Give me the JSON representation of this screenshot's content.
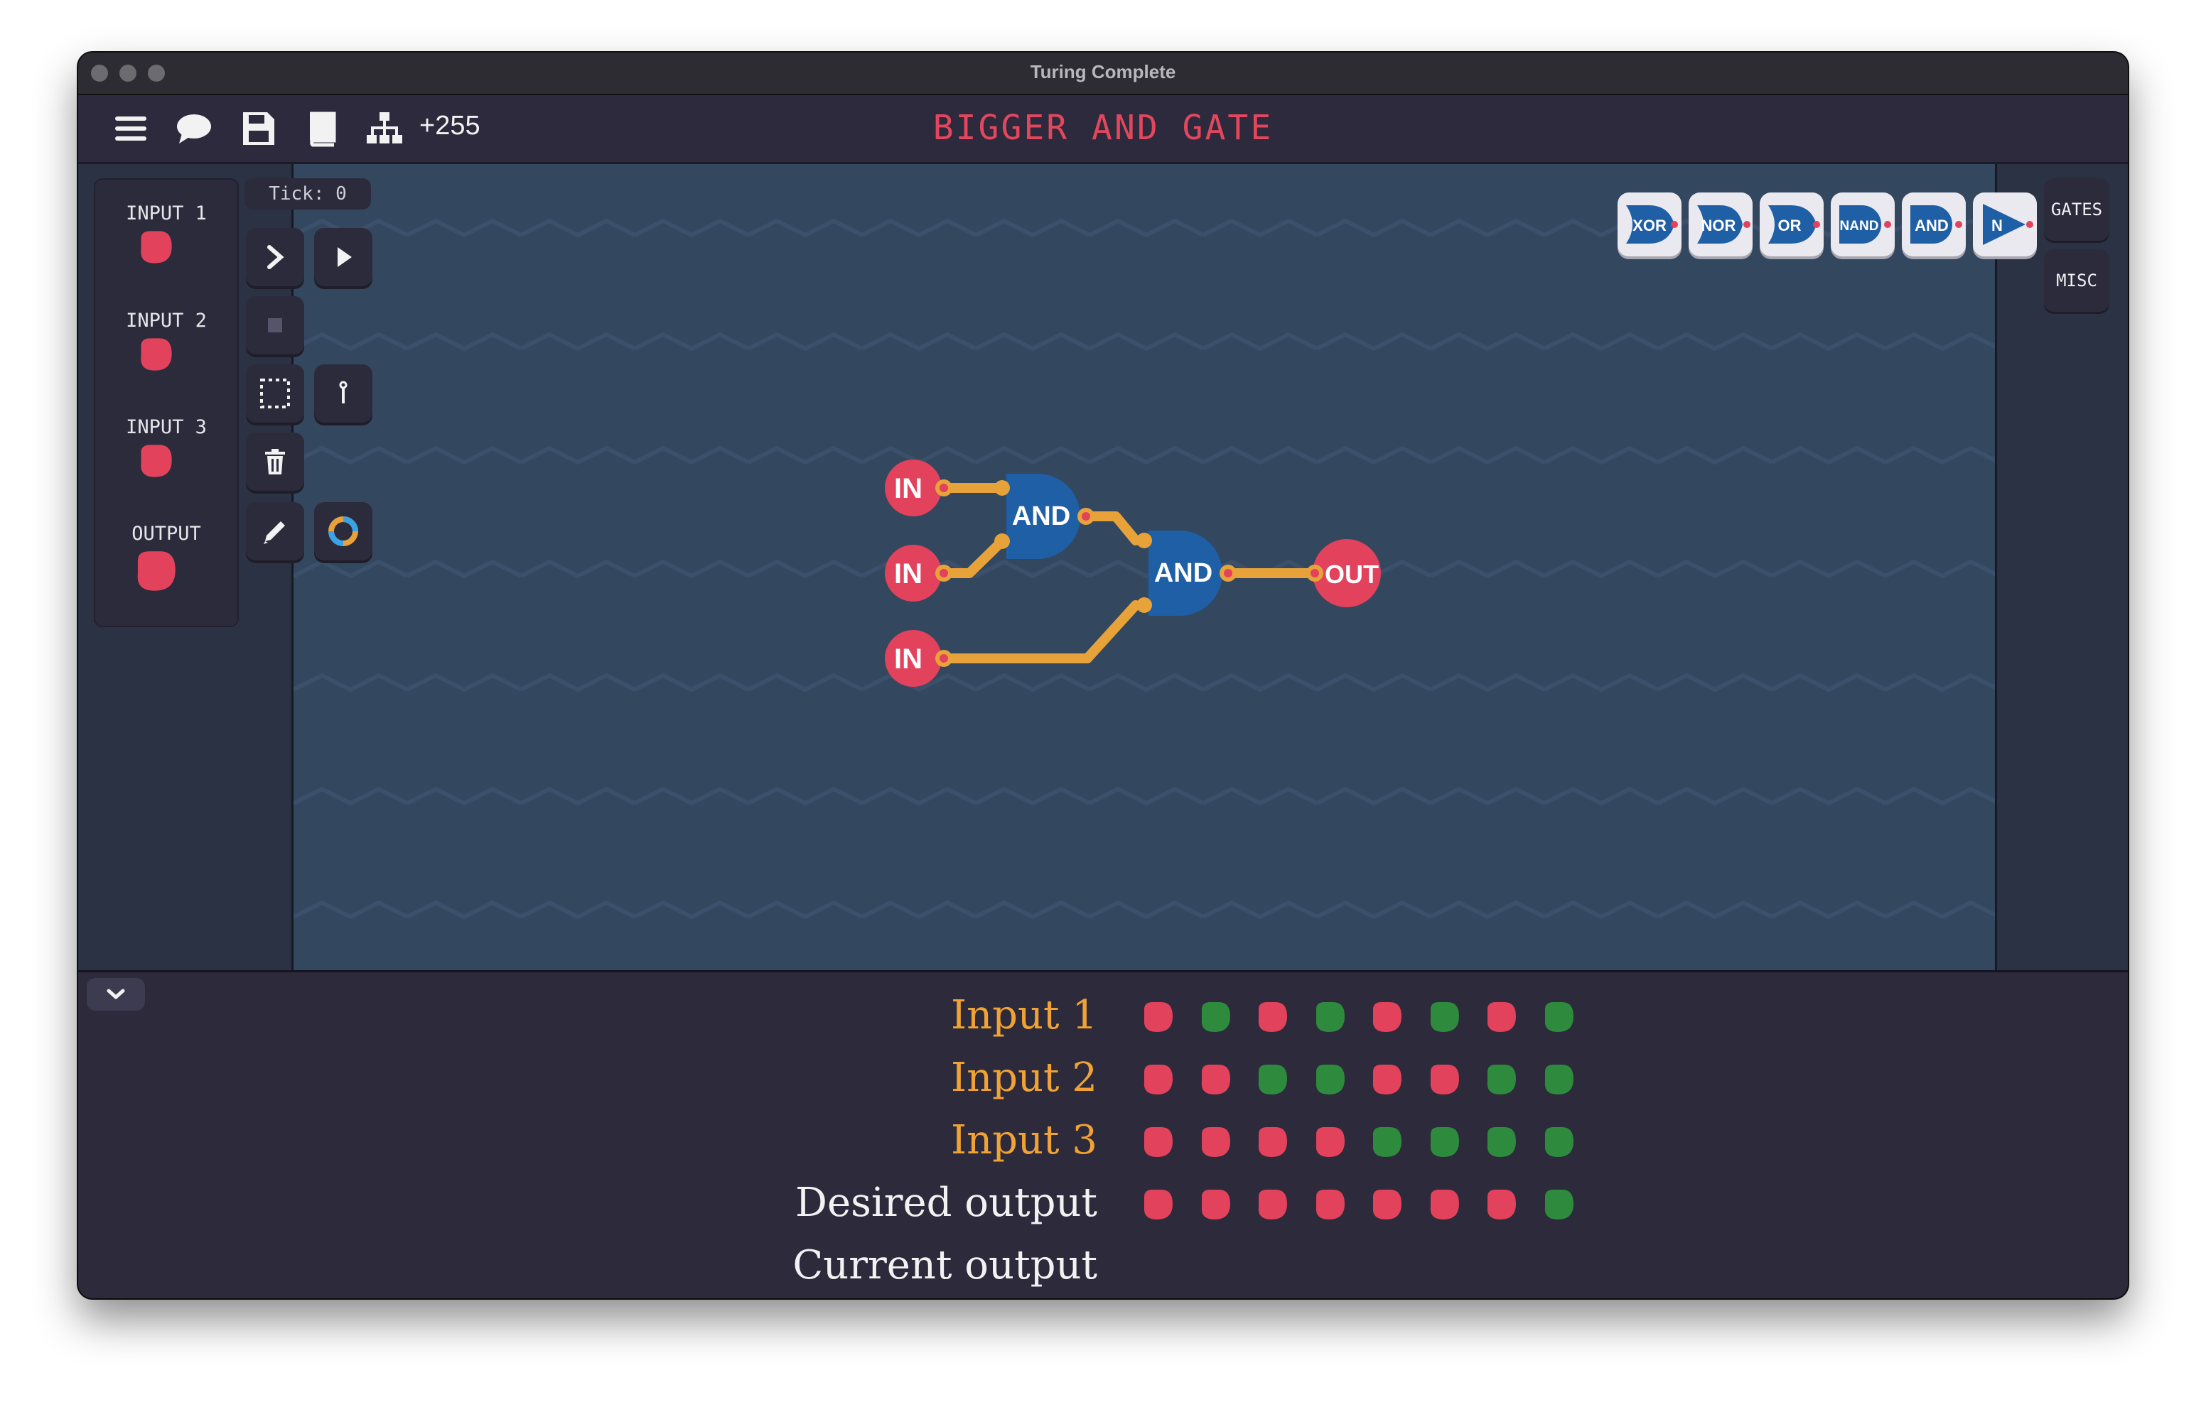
{
  "window": {
    "title": "Turing Complete"
  },
  "toolbar": {
    "icons": [
      "menu-icon",
      "chat-icon",
      "save-icon",
      "manual-icon",
      "hierarchy-icon"
    ],
    "count": "+255"
  },
  "level": {
    "title": "BIGGER AND GATE"
  },
  "io_panel": {
    "items": [
      {
        "label": "INPUT 1",
        "state": "off"
      },
      {
        "label": "INPUT 2",
        "state": "off"
      },
      {
        "label": "INPUT 3",
        "state": "off"
      },
      {
        "label": "OUTPUT",
        "state": "off"
      }
    ]
  },
  "sim": {
    "tick": "Tick: 0"
  },
  "tools": [
    "step-icon",
    "play-icon",
    "stop-icon",
    "select-icon",
    "wire-probe-icon",
    "trash-icon",
    "pencil-icon",
    "color-ring-icon"
  ],
  "palette": {
    "gates": [
      "XOR",
      "NOR",
      "OR",
      "NAND",
      "AND",
      "N"
    ],
    "tabs": [
      "GATES",
      "MISC"
    ]
  },
  "circuit": {
    "inputs": [
      "IN",
      "IN",
      "IN"
    ],
    "gates": [
      "AND",
      "AND"
    ],
    "output": "OUT"
  },
  "truth_table": {
    "rows": [
      {
        "label": "Input 1",
        "values": [
          0,
          1,
          0,
          1,
          0,
          1,
          0,
          1
        ]
      },
      {
        "label": "Input 2",
        "values": [
          0,
          0,
          1,
          1,
          0,
          0,
          1,
          1
        ]
      },
      {
        "label": "Input 3",
        "values": [
          0,
          0,
          0,
          0,
          1,
          1,
          1,
          1
        ]
      },
      {
        "label": "Desired output",
        "values": [
          0,
          0,
          0,
          0,
          0,
          0,
          0,
          1
        ]
      },
      {
        "label": "Current output",
        "values": []
      }
    ]
  },
  "colors": {
    "on": "#2e8b3e",
    "off": "#e2425b",
    "wire": "#e8a23a",
    "gate": "#1f5fa6",
    "title": "#e2475e",
    "input_label": "#f0a234",
    "text_white": "#f2f2f2"
  }
}
